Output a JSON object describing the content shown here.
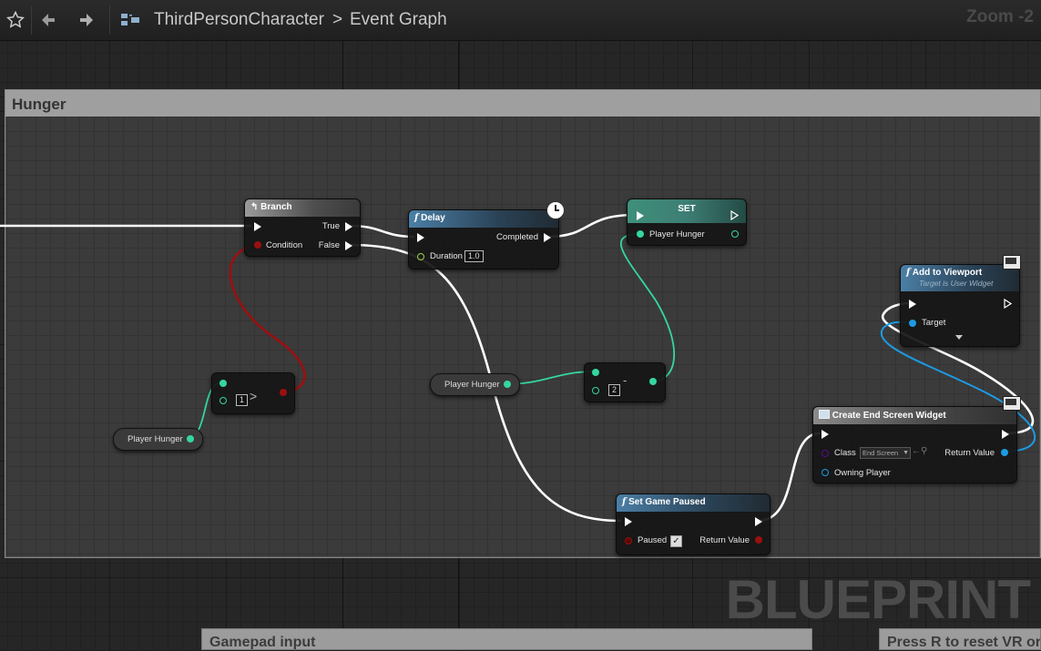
{
  "toolbar": {
    "breadcrumb": {
      "blueprint": "ThirdPersonCharacter",
      "separator": ">",
      "graph": "Event Graph"
    },
    "zoom": "Zoom -2"
  },
  "comments": {
    "hunger": "Hunger",
    "gamepad": "Gamepad input",
    "vr": "Press R to reset VR or"
  },
  "nodes": {
    "branch": {
      "title": "Branch",
      "true_label": "True",
      "condition_label": "Condition",
      "false_label": "False"
    },
    "delay": {
      "title": "Delay",
      "completed_label": "Completed",
      "duration_label": "Duration",
      "duration_value": "1.0"
    },
    "set": {
      "title": "SET",
      "pin_label": "Player Hunger"
    },
    "greater": {
      "operator": ">",
      "value": "1"
    },
    "player_hunger_1": {
      "label": "Player Hunger"
    },
    "player_hunger_2": {
      "label": "Player Hunger"
    },
    "subtract": {
      "operator": "-",
      "value": "2"
    },
    "add_to_viewport": {
      "title": "Add to Viewport",
      "subtitle": "Target is User Widget",
      "target_label": "Target"
    },
    "create_widget": {
      "title": "Create End Screen Widget",
      "class_label": "Class",
      "class_value": "End Screen",
      "return_label": "Return Value",
      "owning_label": "Owning Player"
    },
    "set_game_paused": {
      "title": "Set Game Paused",
      "paused_label": "Paused",
      "return_label": "Return Value"
    }
  },
  "watermark": "BLUEPRINT",
  "colors": {
    "exec_wire": "#ffffff",
    "float_pin": "#35d6a0",
    "bool_pin": "#9a1010",
    "object_pin": "#1c9be3",
    "class_pin": "#5a0c8a"
  }
}
